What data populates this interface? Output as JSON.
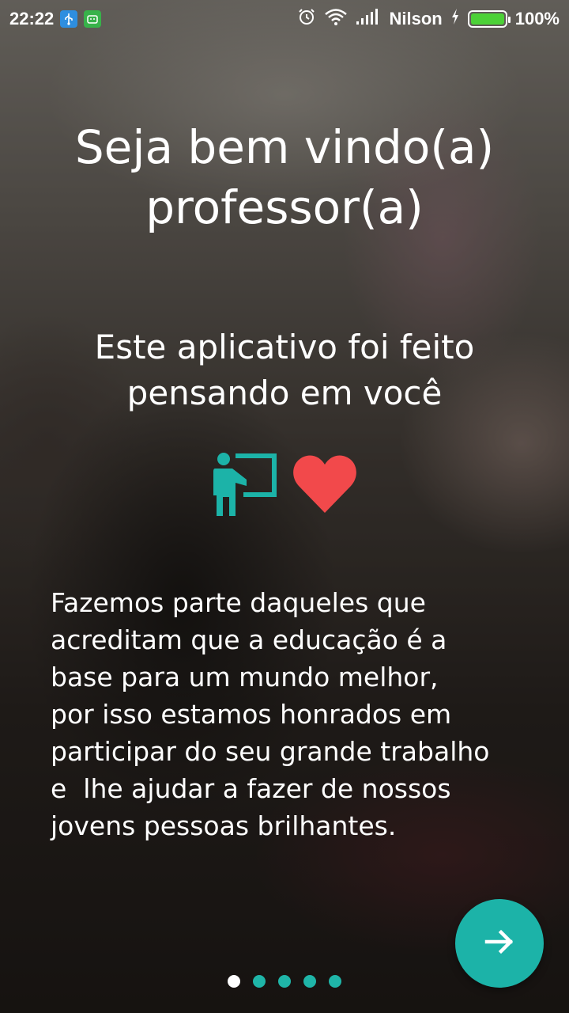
{
  "status_bar": {
    "time": "22:22",
    "carrier": "Nilson",
    "battery_percent": "100%",
    "battery_level": 1.0,
    "icons": [
      "usb-icon",
      "android-debug-icon",
      "alarm-icon",
      "wifi-icon",
      "signal-icon",
      "charging-icon",
      "battery-icon"
    ]
  },
  "onboarding": {
    "title_line1": "Seja bem vindo(a)",
    "title_line2": "professor(a)",
    "subtitle_line1": "Este aplicativo foi feito",
    "subtitle_line2": "pensando em você",
    "icons": [
      "teacher-icon",
      "heart-icon"
    ],
    "body": "Fazemos parte daqueles que\nacreditam que a educação é a\nbase para um mundo melhor,\npor isso estamos honrados em\nparticipar do seu grande trabalho\ne  lhe ajudar a fazer de nossos\njovens pessoas brilhantes."
  },
  "pager": {
    "page_count": 5,
    "current_page": 1
  },
  "next_button": {
    "icon": "arrow-right-icon"
  },
  "colors": {
    "accent": "#1cb3a8",
    "heart": "#f2494b",
    "dot_inactive": "#1fb5a8",
    "dot_active": "#ffffff"
  }
}
